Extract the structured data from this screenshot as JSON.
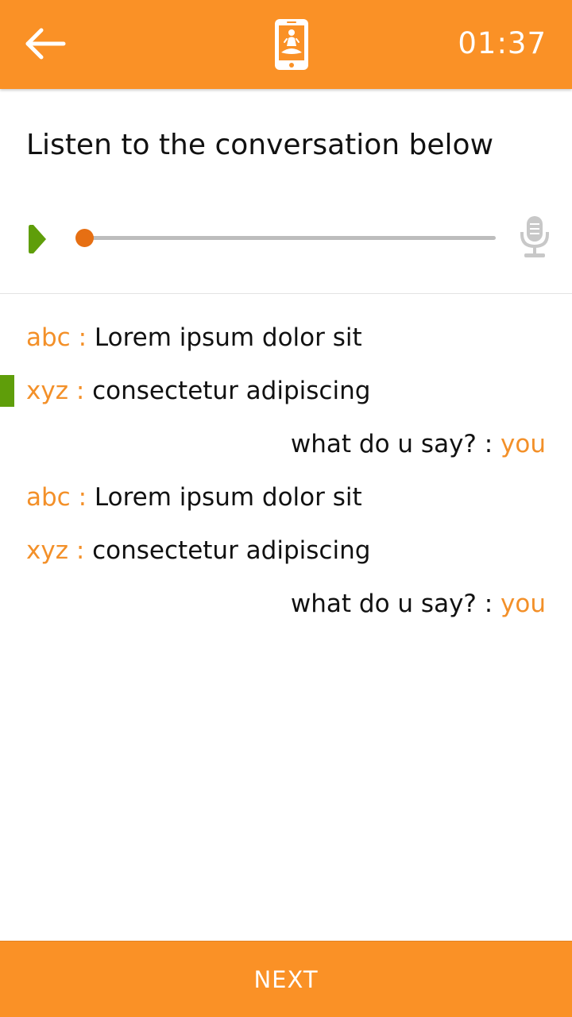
{
  "header": {
    "back_icon": "arrow-left-icon",
    "app_icon": "phone-meditation-icon",
    "timer": "01:37",
    "color": "#FA9126"
  },
  "prompt": "Listen to the conversation below",
  "player": {
    "play_icon": "play-icon",
    "mic_icon": "microphone-icon",
    "progress": 0,
    "play_color": "#5F9E0A",
    "thumb_color": "#E66F13"
  },
  "conversation": [
    {
      "speaker": "abc",
      "separator": " : ",
      "text": "Lorem ipsum dolor sit",
      "align": "left",
      "current": false
    },
    {
      "speaker": "xyz",
      "separator": " : ",
      "text": "consectetur adipiscing",
      "align": "left",
      "current": true
    },
    {
      "speaker": "you",
      "separator": " : ",
      "text": "what do u say?",
      "align": "right",
      "current": false
    },
    {
      "speaker": "abc",
      "separator": " : ",
      "text": "Lorem ipsum dolor sit",
      "align": "left",
      "current": false
    },
    {
      "speaker": "xyz",
      "separator": " : ",
      "text": "consectetur adipiscing",
      "align": "left",
      "current": false
    },
    {
      "speaker": "you",
      "separator": " : ",
      "text": "what do u say?",
      "align": "right",
      "current": false
    }
  ],
  "next_label": "NEXT"
}
